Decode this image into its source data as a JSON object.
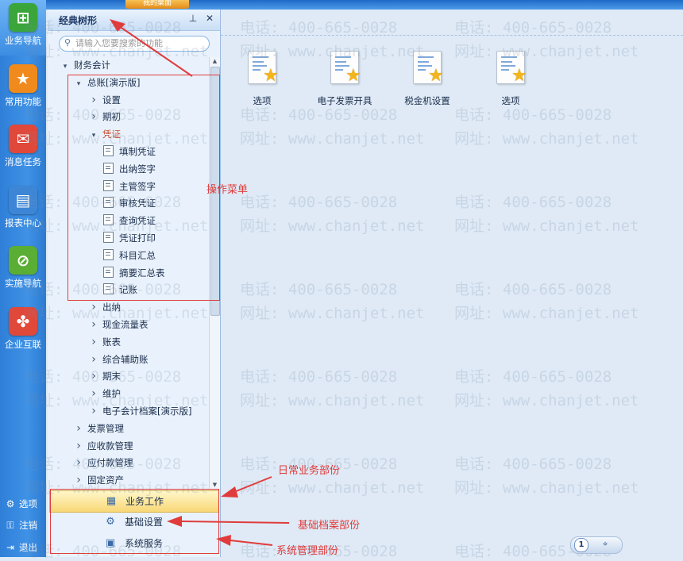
{
  "rail": {
    "items": [
      {
        "label": "业务导航",
        "icon": "business-nav-icon",
        "color": "#3aa53a",
        "glyph": "⊞"
      },
      {
        "label": "常用功能",
        "icon": "star-icon",
        "color": "#f08a1c",
        "glyph": "★"
      },
      {
        "label": "消息任务",
        "icon": "mail-icon",
        "color": "#e0483a",
        "glyph": "✉"
      },
      {
        "label": "报表中心",
        "icon": "report-icon",
        "color": "#3d86d6",
        "glyph": "▤"
      },
      {
        "label": "实施导航",
        "icon": "compass-icon",
        "color": "#5aae34",
        "glyph": "⊘"
      },
      {
        "label": "企业互联",
        "icon": "connect-icon",
        "color": "#e0483a",
        "glyph": "✤"
      }
    ],
    "bottom": [
      {
        "label": "选项",
        "icon": "gear-icon",
        "glyph": "⚙"
      },
      {
        "label": "注销",
        "icon": "key-icon",
        "glyph": "⚿"
      },
      {
        "label": "退出",
        "icon": "exit-icon",
        "glyph": "⇥"
      }
    ]
  },
  "topbar": {
    "tab_label": "我的桌面"
  },
  "panel": {
    "title": "经典树形",
    "pin_glyph": "📌",
    "close_glyph": "✕",
    "search_placeholder": "请输入您要搜索的功能",
    "tree": [
      {
        "label": "财务会计",
        "level": 0,
        "state": "open"
      },
      {
        "label": "总账[演示版]",
        "level": 1,
        "state": "open"
      },
      {
        "label": "设置",
        "level": 2,
        "state": "closed"
      },
      {
        "label": "期初",
        "level": 2,
        "state": "closed"
      },
      {
        "label": "凭证",
        "level": 2,
        "state": "open",
        "selected": true
      },
      {
        "label": "填制凭证",
        "level": 3,
        "state": "leaf"
      },
      {
        "label": "出纳签字",
        "level": 3,
        "state": "leaf"
      },
      {
        "label": "主管签字",
        "level": 3,
        "state": "leaf"
      },
      {
        "label": "审核凭证",
        "level": 3,
        "state": "leaf"
      },
      {
        "label": "查询凭证",
        "level": 3,
        "state": "leaf"
      },
      {
        "label": "凭证打印",
        "level": 3,
        "state": "leaf"
      },
      {
        "label": "科目汇总",
        "level": 3,
        "state": "leaf"
      },
      {
        "label": "摘要汇总表",
        "level": 3,
        "state": "leaf"
      },
      {
        "label": "记账",
        "level": 3,
        "state": "leaf"
      },
      {
        "label": "出纳",
        "level": 2,
        "state": "closed"
      },
      {
        "label": "现金流量表",
        "level": 2,
        "state": "closed"
      },
      {
        "label": "账表",
        "level": 2,
        "state": "closed"
      },
      {
        "label": "综合辅助账",
        "level": 2,
        "state": "closed"
      },
      {
        "label": "期末",
        "level": 2,
        "state": "closed"
      },
      {
        "label": "维护",
        "level": 2,
        "state": "closed"
      },
      {
        "label": "电子会计档案[演示版]",
        "level": 2,
        "state": "closed"
      },
      {
        "label": "发票管理",
        "level": 1,
        "state": "closed"
      },
      {
        "label": "应收款管理",
        "level": 1,
        "state": "closed"
      },
      {
        "label": "应付款管理",
        "level": 1,
        "state": "closed"
      },
      {
        "label": "固定资产",
        "level": 1,
        "state": "closed"
      }
    ],
    "sections": [
      {
        "label": "业务工作",
        "icon": "business-work-icon",
        "glyph": "▦",
        "active": true
      },
      {
        "label": "基础设置",
        "icon": "settings-gear-icon",
        "glyph": "⚙",
        "active": false
      },
      {
        "label": "系统服务",
        "icon": "system-service-icon",
        "glyph": "▣",
        "active": false
      }
    ]
  },
  "desktop": {
    "tiles": [
      {
        "label": "选项"
      },
      {
        "label": "电子发票开具"
      },
      {
        "label": "税金机设置"
      },
      {
        "label": "选项"
      }
    ],
    "pager_number": "1"
  },
  "watermark": {
    "phone": "电话: 400-665-0028",
    "site": "网址: www.chanjet.net"
  },
  "annotations": {
    "menu": "操作菜单",
    "daily": "日常业务部份",
    "basic": "基础档案部份",
    "system": "系统管理部份",
    "color": "#e03c3c"
  }
}
